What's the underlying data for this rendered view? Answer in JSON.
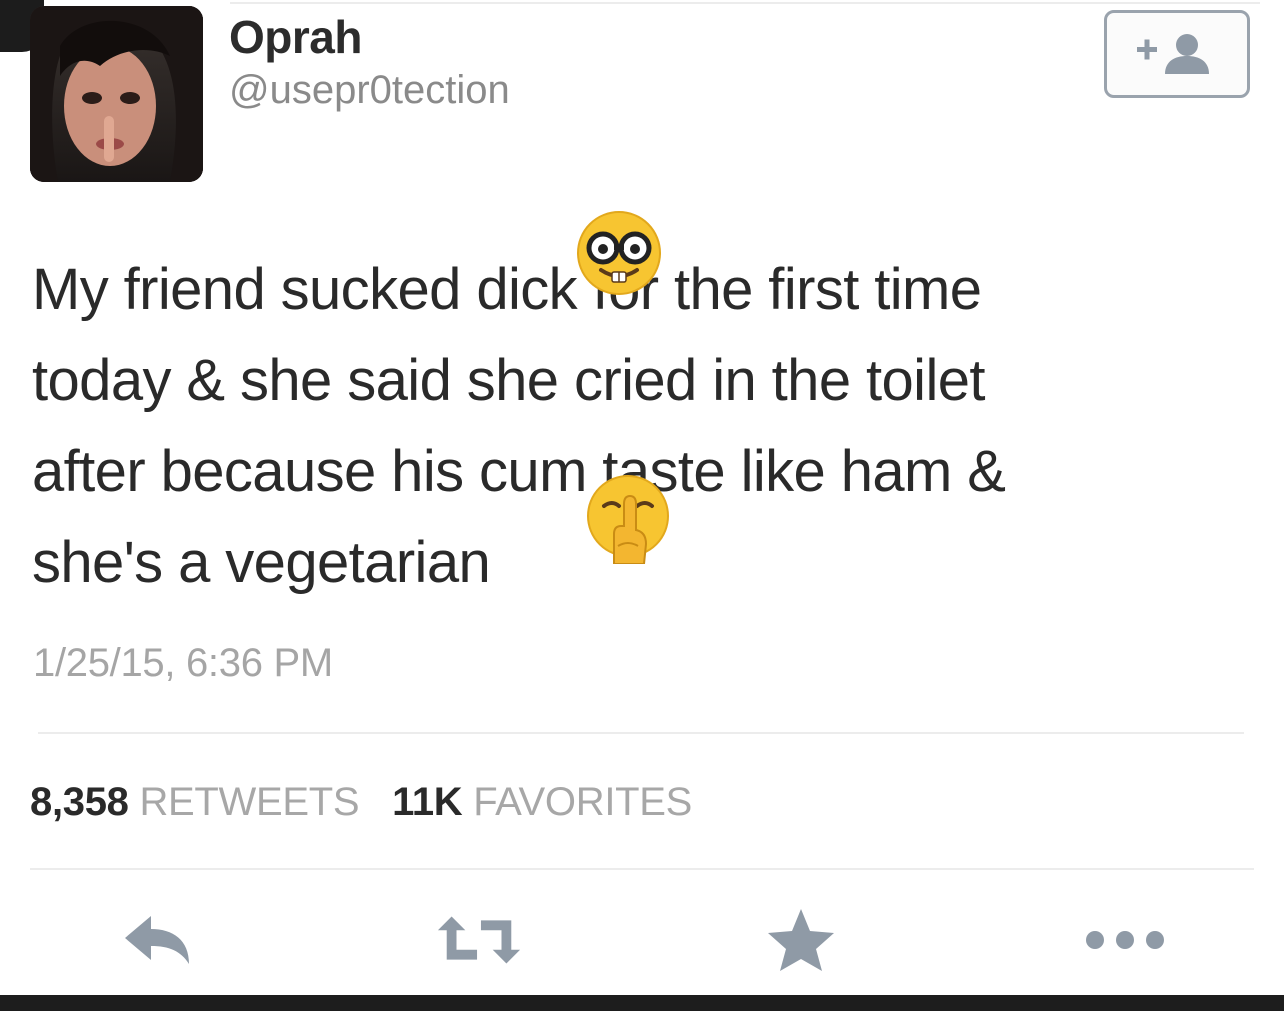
{
  "tweet": {
    "display_name": "Oprah",
    "handle": "@usepr0tection",
    "text_lines": [
      "My friend sucked dick for the first time",
      "today & she said she cried in the toilet",
      "after because his cum taste like ham &",
      "she's a vegetarian"
    ],
    "timestamp": "1/25/15, 6:36 PM",
    "retweets_count": "8,358",
    "retweets_label": "RETWEETS",
    "favorites_count": "11K",
    "favorites_label": "FAVORITES"
  },
  "overlay_emojis": [
    "nerd-face",
    "shushing-face"
  ],
  "actions": [
    "reply-icon",
    "retweet-icon",
    "favorite-icon",
    "more-icon"
  ],
  "colors": {
    "text": "#2a2a2a",
    "muted": "#a7a7a7",
    "icon": "#8f9aa6",
    "emoji_yellow": "#f7c531"
  }
}
